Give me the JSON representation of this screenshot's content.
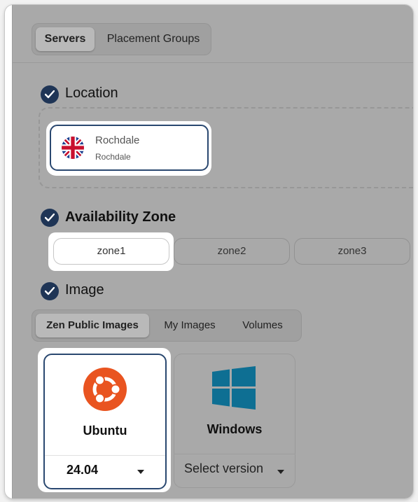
{
  "top_tabs": [
    {
      "label": "Servers",
      "active": true
    },
    {
      "label": "Placement Groups",
      "active": false
    }
  ],
  "sections": {
    "location": {
      "title": "Location"
    },
    "availability_zone": {
      "title": "Availability Zone"
    },
    "image": {
      "title": "Image"
    }
  },
  "location": {
    "selected": {
      "name": "Rochdale",
      "sub": "Rochdale",
      "flag_icon": "uk-flag-icon"
    }
  },
  "zones": [
    {
      "label": "zone1",
      "selected": true
    },
    {
      "label": "zone2",
      "selected": false
    },
    {
      "label": "zone3",
      "selected": false
    }
  ],
  "image_tabs": [
    {
      "label": "Zen Public Images",
      "active": true
    },
    {
      "label": "My Images",
      "active": false
    },
    {
      "label": "Volumes",
      "active": false
    }
  ],
  "images": [
    {
      "name": "Ubuntu",
      "version": "24.04",
      "icon": "ubuntu-logo-icon",
      "selected": true
    },
    {
      "name": "Windows",
      "version": "Select version",
      "icon": "windows-logo-icon",
      "selected": false
    }
  ],
  "colors": {
    "accent": "#1f3556",
    "ubuntu_orange": "#e95420",
    "windows_blue": "#0e6f93"
  }
}
